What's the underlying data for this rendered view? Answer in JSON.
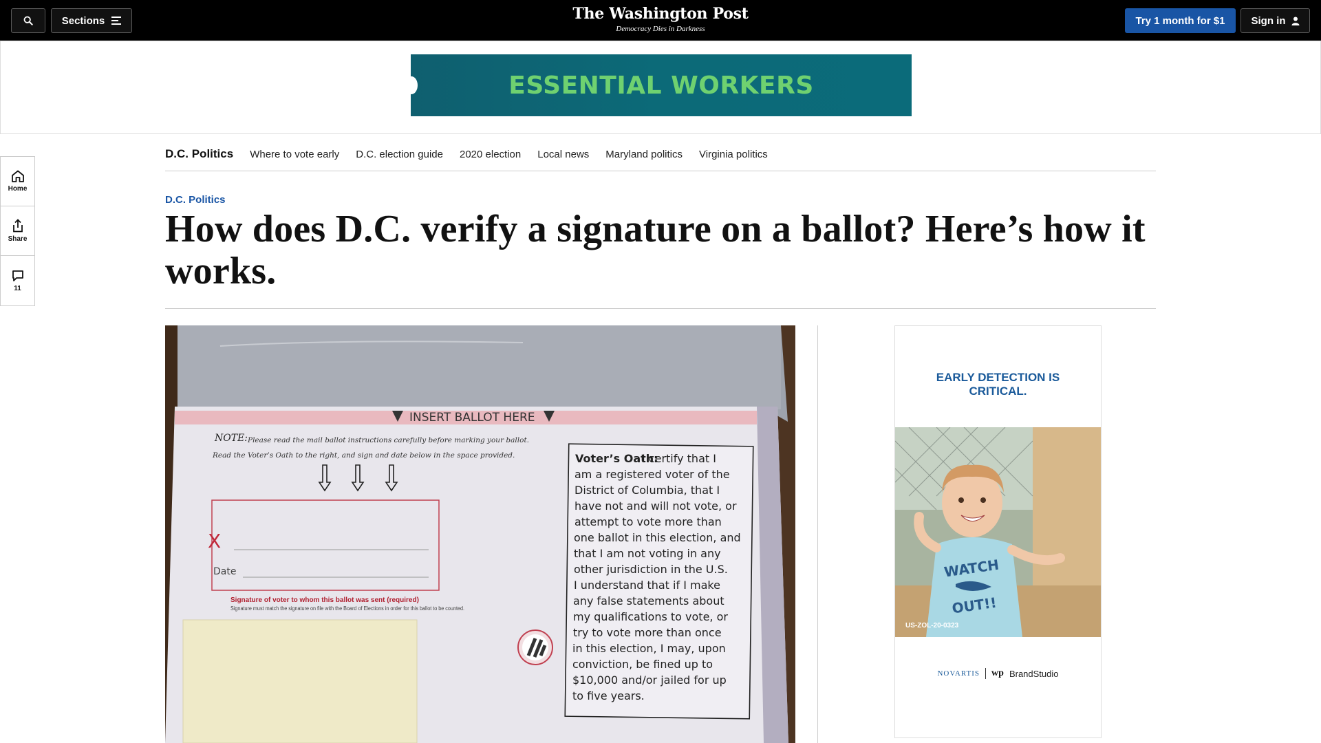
{
  "topbar": {
    "sections_label": "Sections",
    "logo": "The Washington Post",
    "tagline": "Democracy Dies in Darkness",
    "try_label": "Try 1 month for $1",
    "signin_label": "Sign in"
  },
  "top_ad": {
    "text": "ESSENTIAL WORKERS"
  },
  "rail": {
    "home_label": "Home",
    "share_label": "Share",
    "comments_count": "11"
  },
  "subnav": {
    "title": "D.C. Politics",
    "links": [
      "Where to vote early",
      "D.C. election guide",
      "2020 election",
      "Local news",
      "Maryland politics",
      "Virginia politics"
    ]
  },
  "article": {
    "kicker": "D.C. Politics",
    "headline": "How does D.C. verify a signature on a ballot? Here’s how it works."
  },
  "ballot": {
    "insert_text": "INSERT BALLOT HERE",
    "note_label": "NOTE:",
    "note_line1": "Please read the mail ballot instructions carefully before marking your ballot.",
    "note_line2": "Read the Voter’s Oath to the right, and sign and date below in the space provided.",
    "x_mark": "X",
    "date_label": "Date",
    "sig_required": "Signature of voter to whom this ballot was sent (required)",
    "sig_note": "Signature must match the signature on file with the Board of Elections in order for this ballot to be counted.",
    "oath_title": "Voter’s Oath:",
    "oath_lines": [
      "I certify that I",
      "am a registered voter of the",
      "District of Columbia, that I",
      "have not and will not vote, or",
      "attempt to vote more than",
      "one ballot in this election, and",
      "that I am not voting in any",
      "other jurisdiction in the U.S.",
      "I understand that if I make",
      "any false statements about",
      "my qualifications to vote, or",
      "try to vote more than once",
      "in this election, I may, upon",
      "conviction, be fined up to",
      "$10,000 and/or jailed for up",
      "to five years."
    ]
  },
  "side_ad": {
    "headline_line1": "EARLY DETECTION IS",
    "headline_line2": "CRITICAL.",
    "shirt_line1": "WATCH",
    "shirt_line2": "OUT!!",
    "code": "US-ZOL-20-0323",
    "brand1": "NOVARTIS",
    "brand2_mark": "wp",
    "brand2": "BrandStudio"
  },
  "colors": {
    "topbar_bg": "#000000",
    "cta_blue": "#1955a5",
    "kicker_blue": "#1955a5",
    "ad_green_text": "#6fd170",
    "ad_teal_bg": "#0c6a78"
  }
}
